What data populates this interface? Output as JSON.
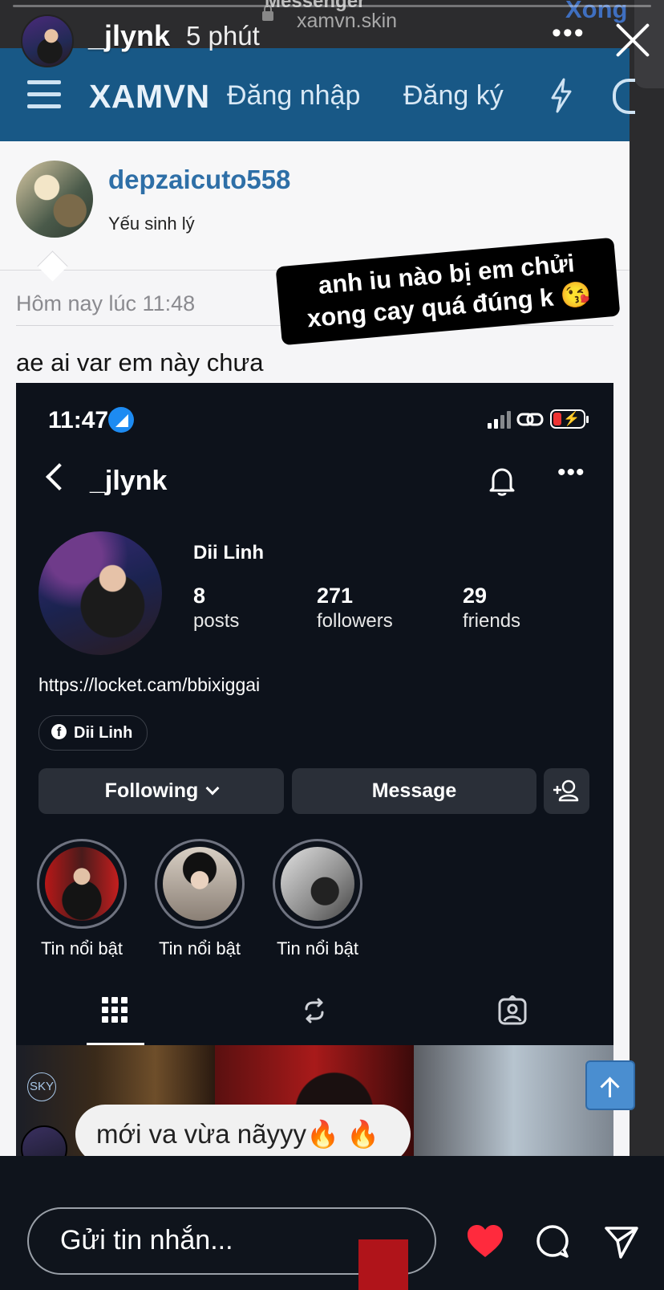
{
  "browser": {
    "title": "Messenger",
    "url": "xamvn.skin",
    "done": "Xong"
  },
  "forum": {
    "brand": "XAMVN",
    "login": "Đăng nhập",
    "register": "Đăng ký",
    "author": "depzaicuto558",
    "author_title": "Yếu sinh lý",
    "post_date": "Hôm nay lúc 11:48",
    "post_text": "ae ai var em này chưa"
  },
  "sticker": {
    "line1": "anh iu nào bị em chửi",
    "line2": "xong cay quá đúng k 😘"
  },
  "instagram": {
    "time": "11:47",
    "username": "_jlynk",
    "display_name": "Dii Linh",
    "stats": [
      {
        "value": "8",
        "label": "posts"
      },
      {
        "value": "271",
        "label": "followers"
      },
      {
        "value": "29",
        "label": "friends"
      }
    ],
    "bio_link": "https://locket.cam/bbixiggai",
    "fb_chip": "Dii Linh",
    "following_btn": "Following",
    "message_btn": "Message",
    "highlights": [
      "Tin nổi bật",
      "Tin nổi bật",
      "Tin nổi bật"
    ],
    "thumb_badge": "SKY"
  },
  "story": {
    "username": "_jlynk",
    "time_ago": "5 phút",
    "reply_bubble": "mới va vừa nãyyy🔥 🔥",
    "reply_placeholder": "Gửi tin nhắn..."
  },
  "colors": {
    "navbar": "#185886",
    "brand_link": "#2e6fa7",
    "heart": "#ff2a3d",
    "ig_bg": "#0d121b"
  }
}
